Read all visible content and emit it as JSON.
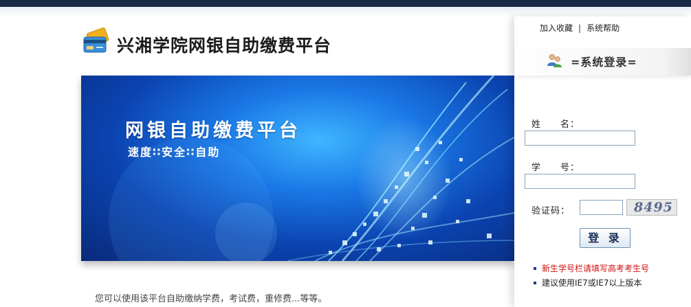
{
  "header": {
    "title": "兴湘学院网银自助缴费平台"
  },
  "banner": {
    "title": "网银自助缴费平台",
    "subtitle": "速度∷安全∷自助"
  },
  "description": "您可以使用该平台自助缴纳学费，考试费，重修费...等等。",
  "top_links": {
    "favorite": "加入收藏",
    "separator": "|",
    "help": "系统帮助"
  },
  "login": {
    "title": "=系统登录=",
    "name_label": "姓　　名：",
    "student_id_label": "学　　号：",
    "captcha_label": "验证码：",
    "name_value": "",
    "student_id_value": "",
    "captcha_value": "",
    "captcha_image_text": "8495",
    "submit_label": "登 录"
  },
  "notes": [
    {
      "text": "新生学号栏请填写高考考生号",
      "color": "#d01010"
    },
    {
      "text": "建议使用IE7或IE7以上版本",
      "color": "#222222"
    }
  ],
  "icons": {
    "logo": "bank-card-icon",
    "login": "users-icon"
  }
}
